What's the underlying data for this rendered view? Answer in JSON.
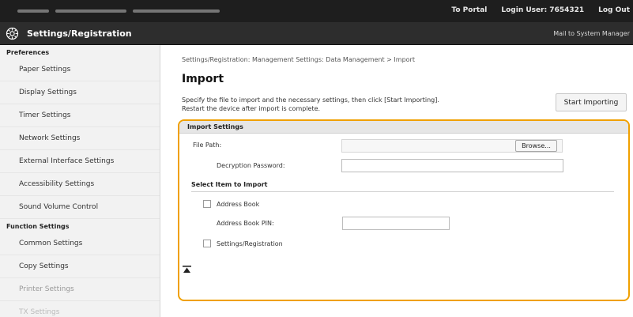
{
  "topbar": {
    "to_portal": "To Portal",
    "login_user": "Login User:  7654321",
    "log_out": "Log Out"
  },
  "header": {
    "title": "Settings/Registration",
    "mail": "Mail to System Manager"
  },
  "sidebar": {
    "preferences_label": "Preferences",
    "preferences_items": [
      "Paper Settings",
      "Display Settings",
      "Timer Settings",
      "Network Settings",
      "External Interface Settings",
      "Accessibility Settings",
      "Sound Volume Control"
    ],
    "function_label": "Function Settings",
    "function_items": [
      "Common Settings",
      "Copy Settings",
      "Printer Settings",
      "TX Settings"
    ]
  },
  "main": {
    "breadcrumb": "Settings/Registration: Management Settings: Data Management > Import",
    "title": "Import",
    "desc_line1": "Specify the file to import and the necessary settings, then click [Start Importing].",
    "desc_line2": "Restart the device after import is complete.",
    "start_button": "Start Importing"
  },
  "panel": {
    "header": "Import Settings",
    "file_path_label": "File Path:",
    "browse_label": "Browse...",
    "decryption_label": "Decryption Password:",
    "select_label": "Select Item to Import",
    "address_book_label": "Address Book",
    "address_book_pin_label": "Address Book PIN:",
    "settings_label": "Settings/Registration"
  }
}
